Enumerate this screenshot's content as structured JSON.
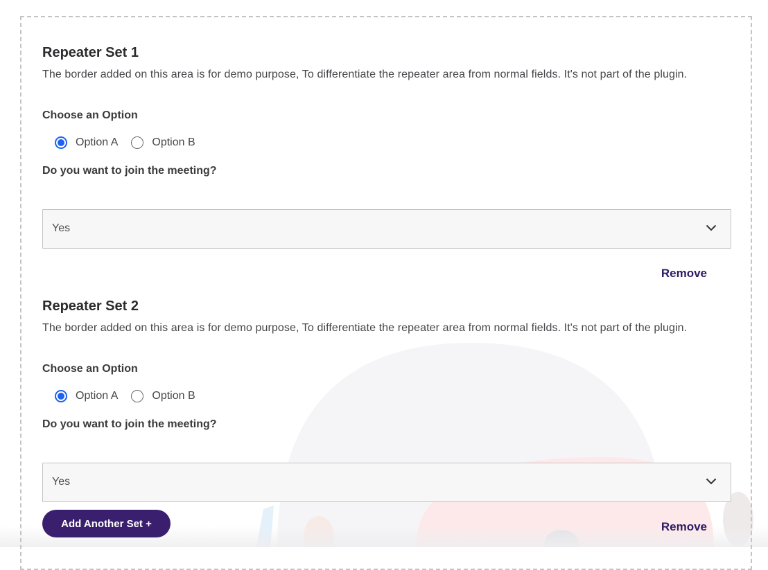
{
  "repeater_sets": [
    {
      "title": "Repeater Set 1",
      "description": "The border added on this area is for demo purpose, To differentiate the repeater area from normal fields. It's not part of the plugin.",
      "choose_label": "Choose an Option",
      "options": [
        {
          "label": "Option A",
          "checked": true
        },
        {
          "label": "Option B",
          "checked": false
        }
      ],
      "meeting_label": "Do you want to join the meeting?",
      "meeting_value": "Yes",
      "remove_label": "Remove"
    },
    {
      "title": "Repeater Set 2",
      "description": "The border added on this area is for demo purpose, To differentiate the repeater area from normal fields. It's not part of the plugin.",
      "choose_label": "Choose an Option",
      "options": [
        {
          "label": "Option A",
          "checked": true
        },
        {
          "label": "Option B",
          "checked": false
        }
      ],
      "meeting_label": "Do you want to join the meeting?",
      "meeting_value": "Yes",
      "remove_label": "Remove"
    }
  ],
  "add_button_label": "Add Another Set +",
  "colors": {
    "accent_purple": "#3a1f6e",
    "remove_text": "#2d1b63",
    "radio_blue": "#1d62f0",
    "dashed_border": "#c4c4c4"
  }
}
